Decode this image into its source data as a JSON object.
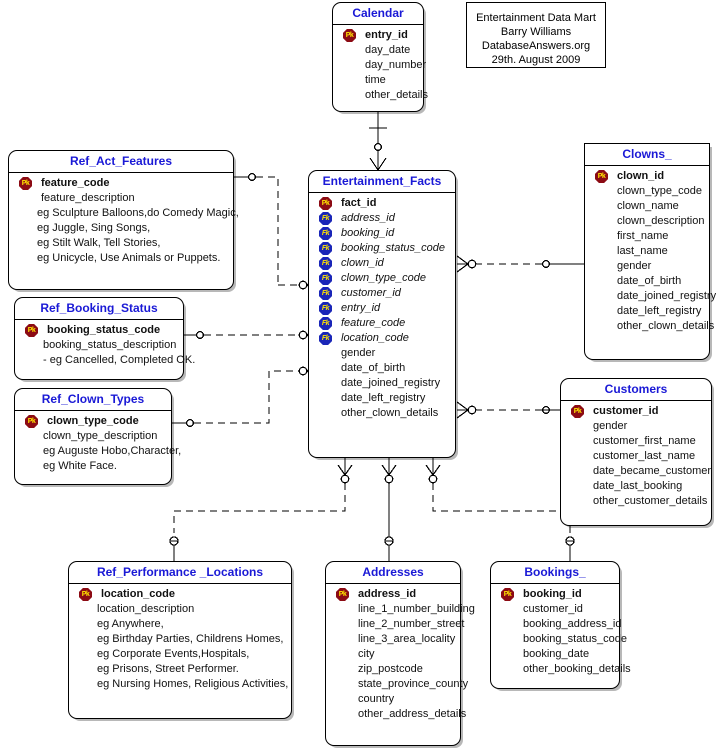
{
  "diagram": {
    "title_block": {
      "lines": [
        "Entertainment Data Mart",
        "Barry Williams",
        "DatabaseAnswers.org",
        "29th. August 2009"
      ]
    },
    "colors": {
      "entity_title": "#1a19d6",
      "pk_badge": "#8c0b14",
      "fk_badge": "#1a26b8",
      "badge_text": "#ffe400",
      "line": "#000000",
      "background": "#ffffff"
    },
    "badge_labels": {
      "pk": "Pk",
      "fk": "Fk"
    },
    "entities": [
      {
        "name": "Calendar",
        "attrs": [
          {
            "text": "entry_id",
            "key": "pk"
          },
          {
            "text": "day_date"
          },
          {
            "text": "day_number"
          },
          {
            "text": "time"
          },
          {
            "text": "other_details"
          }
        ]
      },
      {
        "name": "Ref_Act_Features",
        "attrs": [
          {
            "text": "feature_code",
            "key": "pk"
          },
          {
            "text": "feature_description"
          },
          {
            "text": "eg Sculpture Balloons,do Comedy Magic,"
          },
          {
            "text": "eg Juggle, Sing Songs,"
          },
          {
            "text": "eg Stilt Walk, Tell Stories,"
          },
          {
            "text": "eg Unicycle, Use Animals or Puppets."
          }
        ]
      },
      {
        "name": "Ref_Booking_Status",
        "attrs": [
          {
            "text": "booking_status_code",
            "key": "pk"
          },
          {
            "text": "booking_status_description"
          },
          {
            "text": "- eg Cancelled, Completed OK."
          }
        ]
      },
      {
        "name": "Ref_Clown_Types",
        "attrs": [
          {
            "text": "clown_type_code",
            "key": "pk"
          },
          {
            "text": "clown_type_description"
          },
          {
            "text": "eg Auguste Hobo,Character,"
          },
          {
            "text": "eg White Face."
          }
        ]
      },
      {
        "name": "Entertainment_Facts",
        "attrs": [
          {
            "text": "fact_id",
            "key": "pk"
          },
          {
            "text": "address_id",
            "key": "fk"
          },
          {
            "text": "booking_id",
            "key": "fk"
          },
          {
            "text": "booking_status_code",
            "key": "fk"
          },
          {
            "text": "clown_id",
            "key": "fk"
          },
          {
            "text": "clown_type_code",
            "key": "fk"
          },
          {
            "text": "customer_id",
            "key": "fk"
          },
          {
            "text": "entry_id",
            "key": "fk"
          },
          {
            "text": "feature_code",
            "key": "fk"
          },
          {
            "text": "location_code",
            "key": "fk"
          },
          {
            "text": "gender"
          },
          {
            "text": "date_of_birth"
          },
          {
            "text": "date_joined_registry"
          },
          {
            "text": "date_left_registry"
          },
          {
            "text": "other_clown_details"
          }
        ]
      },
      {
        "name": "Clowns_",
        "attrs": [
          {
            "text": "clown_id",
            "key": "pk"
          },
          {
            "text": "clown_type_code"
          },
          {
            "text": "clown_name"
          },
          {
            "text": "clown_description"
          },
          {
            "text": "first_name"
          },
          {
            "text": "last_name"
          },
          {
            "text": "gender"
          },
          {
            "text": "date_of_birth"
          },
          {
            "text": "date_joined_registry"
          },
          {
            "text": "date_left_registry"
          },
          {
            "text": "other_clown_details"
          }
        ]
      },
      {
        "name": "Customers",
        "attrs": [
          {
            "text": "customer_id",
            "key": "pk"
          },
          {
            "text": "gender"
          },
          {
            "text": "customer_first_name"
          },
          {
            "text": "customer_last_name"
          },
          {
            "text": "date_became_customer"
          },
          {
            "text": "date_last_booking"
          },
          {
            "text": "other_customer_details"
          }
        ]
      },
      {
        "name": "Ref_Performance _Locations",
        "attrs": [
          {
            "text": "location_code",
            "key": "pk"
          },
          {
            "text": "location_description"
          },
          {
            "text": "eg Anywhere,"
          },
          {
            "text": "eg Birthday Parties, Childrens Homes,"
          },
          {
            "text": "eg Corporate Events,Hospitals,"
          },
          {
            "text": "eg Prisons, Street Performer."
          },
          {
            "text": "eg Nursing Homes, Religious Activities,"
          }
        ]
      },
      {
        "name": "Addresses",
        "attrs": [
          {
            "text": "address_id",
            "key": "pk"
          },
          {
            "text": "line_1_number_building"
          },
          {
            "text": "line_2_number_street"
          },
          {
            "text": "line_3_area_locality"
          },
          {
            "text": "city"
          },
          {
            "text": "zip_postcode"
          },
          {
            "text": "state_province_county"
          },
          {
            "text": "country"
          },
          {
            "text": "other_address_details"
          }
        ]
      },
      {
        "name": "Bookings_",
        "attrs": [
          {
            "text": "booking_id",
            "key": "pk"
          },
          {
            "text": "customer_id"
          },
          {
            "text": "booking_address_id"
          },
          {
            "text": "booking_status_code"
          },
          {
            "text": "booking_date"
          },
          {
            "text": "other_booking_details"
          }
        ]
      }
    ],
    "relationships": [
      {
        "from": "Calendar",
        "to": "Entertainment_Facts",
        "style": "solid"
      },
      {
        "from": "Ref_Act_Features",
        "to": "Entertainment_Facts",
        "style": "dashed"
      },
      {
        "from": "Ref_Booking_Status",
        "to": "Entertainment_Facts",
        "style": "dashed"
      },
      {
        "from": "Ref_Clown_Types",
        "to": "Entertainment_Facts",
        "style": "dashed"
      },
      {
        "from": "Clowns_",
        "to": "Entertainment_Facts",
        "style": "dashed"
      },
      {
        "from": "Customers",
        "to": "Entertainment_Facts",
        "style": "dashed"
      },
      {
        "from": "Ref_Performance _Locations",
        "to": "Entertainment_Facts",
        "style": "dashed"
      },
      {
        "from": "Addresses",
        "to": "Entertainment_Facts",
        "style": "solid"
      },
      {
        "from": "Bookings_",
        "to": "Entertainment_Facts",
        "style": "solid"
      }
    ]
  }
}
